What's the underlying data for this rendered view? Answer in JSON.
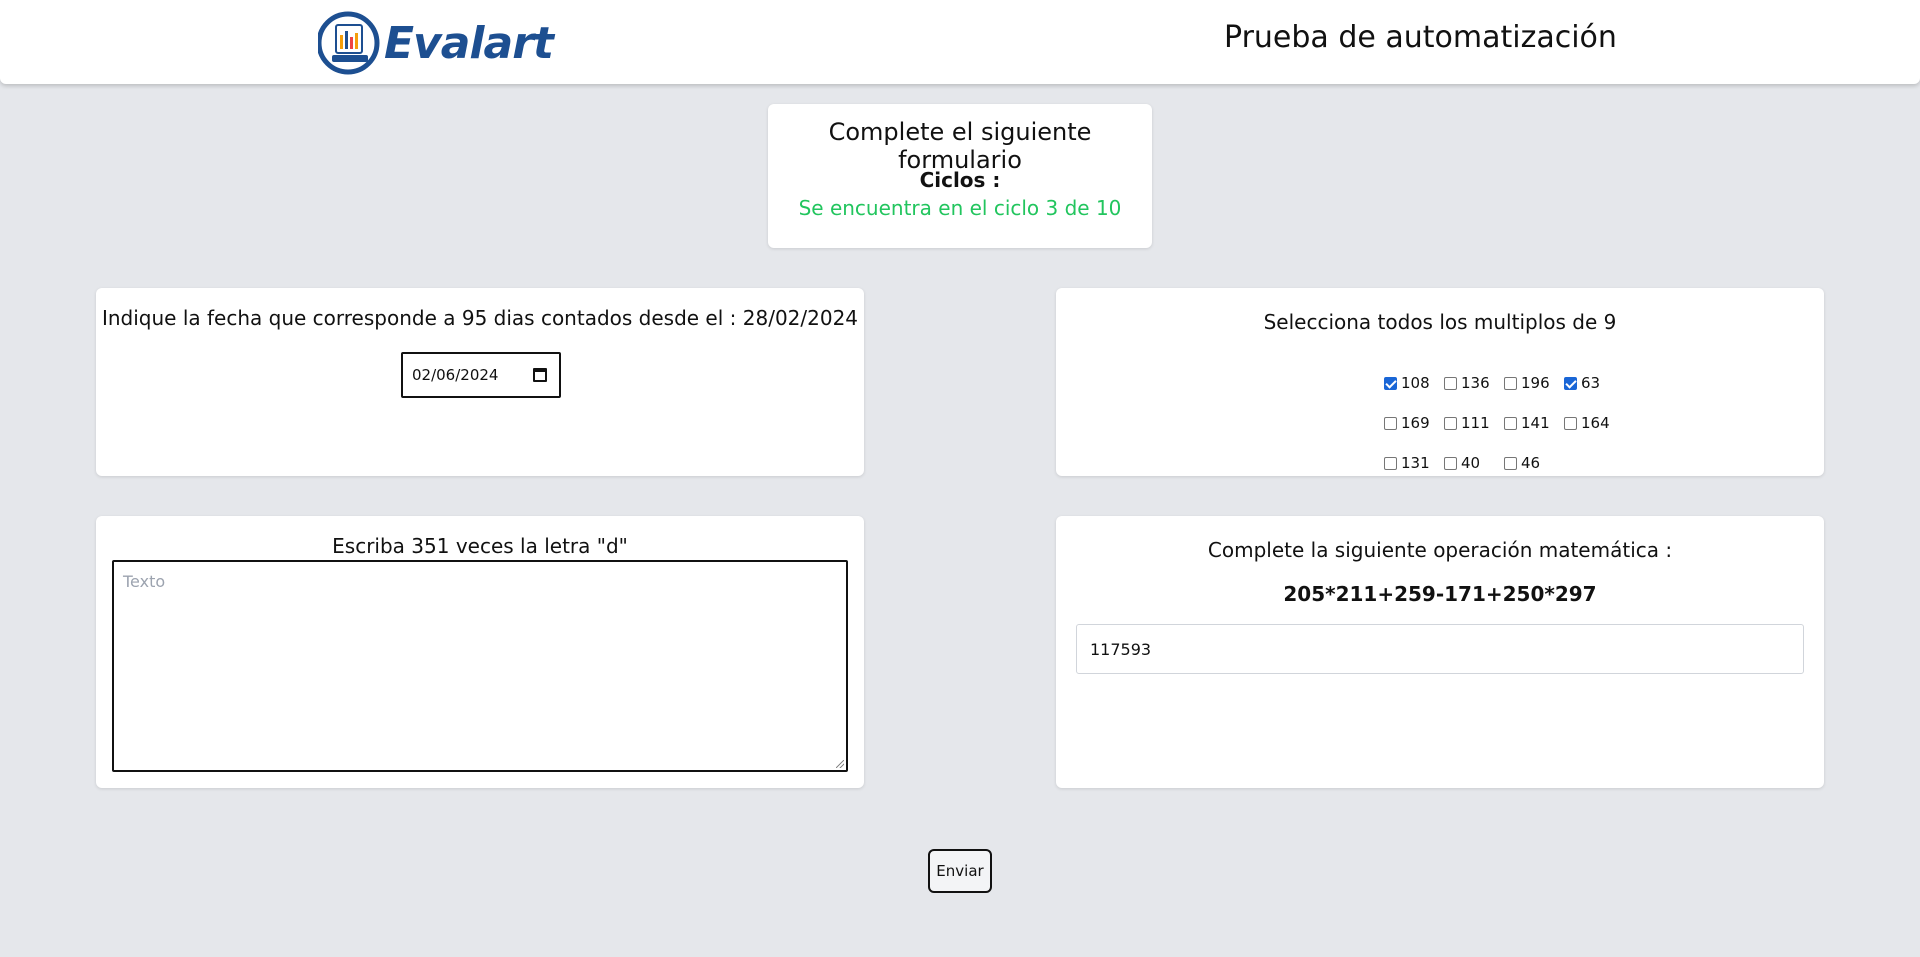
{
  "header": {
    "brand": "Evalart",
    "title": "Prueba de automatización"
  },
  "info": {
    "title": "Complete el siguiente formulario",
    "cycles_label": "Ciclos :",
    "cycles_status": "Se encuentra en el ciclo 3 de 10",
    "status_color": "#22c55e"
  },
  "date_question": {
    "label": "Indique la fecha que corresponde a 95 dias contados desde el : 28/02/2024",
    "value": "02/06/2024"
  },
  "multiples": {
    "label": "Selecciona todos los multiplos de 9",
    "options": [
      {
        "value": "108",
        "checked": true
      },
      {
        "value": "136",
        "checked": false
      },
      {
        "value": "196",
        "checked": false
      },
      {
        "value": "63",
        "checked": true
      },
      {
        "value": "169",
        "checked": false
      },
      {
        "value": "111",
        "checked": false
      },
      {
        "value": "141",
        "checked": false
      },
      {
        "value": "164",
        "checked": false
      },
      {
        "value": "131",
        "checked": false
      },
      {
        "value": "40",
        "checked": false
      },
      {
        "value": "46",
        "checked": false
      }
    ]
  },
  "text_question": {
    "label": "Escriba 351 veces la letra \"d\"",
    "placeholder": "Texto"
  },
  "math_question": {
    "label": "Complete la siguiente operación matemática :",
    "expression": "205*211+259-171+250*297",
    "value": "117593"
  },
  "submit_label": "Enviar",
  "colors": {
    "background": "#e5e7eb",
    "brand": "#1d4f91",
    "checkbox_checked": "#1a66d6"
  }
}
